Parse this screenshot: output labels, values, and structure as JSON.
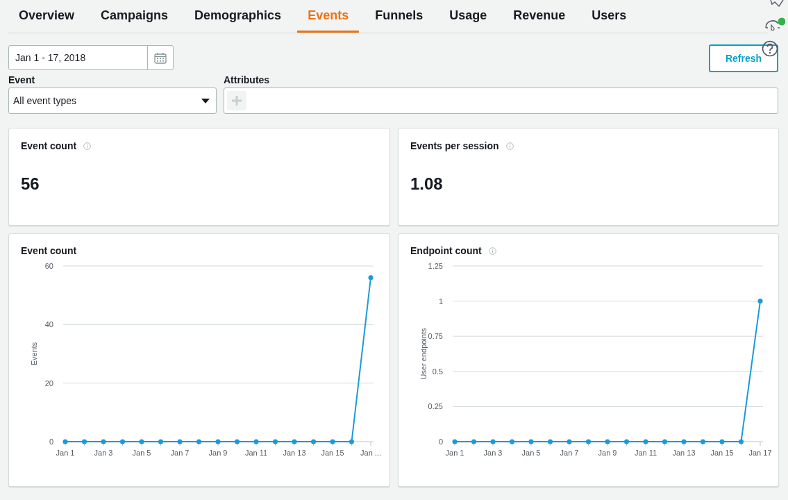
{
  "tabs": [
    {
      "label": "Overview",
      "selected": false
    },
    {
      "label": "Campaigns",
      "selected": false
    },
    {
      "label": "Demographics",
      "selected": false
    },
    {
      "label": "Events",
      "selected": true
    },
    {
      "label": "Funnels",
      "selected": false
    },
    {
      "label": "Usage",
      "selected": false
    },
    {
      "label": "Revenue",
      "selected": false
    },
    {
      "label": "Users",
      "selected": false
    }
  ],
  "date_range": {
    "value": "Jan 1 - 17, 2018"
  },
  "refresh_button": "Refresh",
  "event_filter": {
    "label": "Event",
    "value": "All event types"
  },
  "attributes_filter": {
    "label": "Attributes"
  },
  "metrics": [
    {
      "title": "Event count",
      "value": "56",
      "info": true
    },
    {
      "title": "Events per session",
      "value": "1.08",
      "info": true
    }
  ],
  "charts": [
    {
      "title": "Event count",
      "info": false,
      "chart_data": {
        "type": "line",
        "ylabel": "Events",
        "categories": [
          "Jan 1",
          null,
          "Jan 3",
          null,
          "Jan 5",
          null,
          "Jan 7",
          null,
          "Jan 9",
          null,
          "Jan 11",
          null,
          "Jan 13",
          null,
          "Jan 15",
          null,
          "Jan ..."
        ],
        "series": [
          {
            "color": "#1b9ad8",
            "marker": true,
            "values": [
              0,
              0,
              0,
              0,
              0,
              0,
              0,
              0,
              0,
              0,
              0,
              0,
              0,
              0,
              0,
              0,
              56
            ]
          }
        ],
        "grid": true,
        "ylim": [
          0,
          60
        ],
        "yticks": [
          0,
          20,
          40,
          60
        ]
      }
    },
    {
      "title": "Endpoint count",
      "info": true,
      "chart_data": {
        "type": "line",
        "ylabel": "User endpoints",
        "categories": [
          "Jan 1",
          null,
          "Jan 3",
          null,
          "Jan 5",
          null,
          "Jan 7",
          null,
          "Jan 9",
          null,
          "Jan 11",
          null,
          "Jan 13",
          null,
          "Jan 15",
          null,
          "Jan 17"
        ],
        "series": [
          {
            "color": "#1b9ad8",
            "marker": true,
            "values": [
              0,
              0,
              0,
              0,
              0,
              0,
              0,
              0,
              0,
              0,
              0,
              0,
              0,
              0,
              0,
              0,
              1
            ]
          }
        ],
        "grid": true,
        "ylim": [
          0,
          1.25
        ],
        "yticks": [
          0,
          0.25,
          0.5,
          0.75,
          1,
          1.25
        ]
      }
    }
  ]
}
